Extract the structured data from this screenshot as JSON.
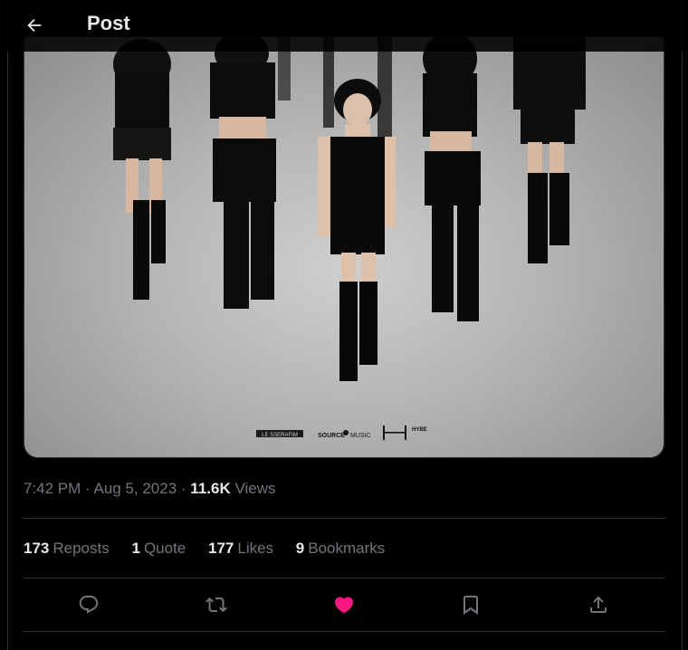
{
  "header": {
    "back_icon": "arrow-left-icon",
    "title": "Post"
  },
  "media": {
    "logos": {
      "label_left": "LE SSERAFIM",
      "label_source": "SOURCE",
      "label_music": "MUSIC",
      "label_hybe": "HYBE"
    }
  },
  "meta": {
    "time": "7:42 PM",
    "separator1": " · ",
    "date": "Aug 5, 2023",
    "separator2": " · ",
    "views_count": "11.6K",
    "views_label": "Views"
  },
  "stats": {
    "reposts_count": "173",
    "reposts_label": "Reposts",
    "quotes_count": "1",
    "quotes_label": "Quote",
    "likes_count": "177",
    "likes_label": "Likes",
    "bookmarks_count": "9",
    "bookmarks_label": "Bookmarks"
  },
  "actions": {
    "reply_icon": "reply-icon",
    "repost_icon": "repost-icon",
    "like_icon": "heart-icon",
    "bookmark_icon": "bookmark-icon",
    "share_icon": "share-icon"
  },
  "colors": {
    "background": "#000000",
    "text_primary": "#e7e9ea",
    "text_secondary": "#71767b",
    "border": "#2f3336",
    "like_active": "#f91880"
  }
}
